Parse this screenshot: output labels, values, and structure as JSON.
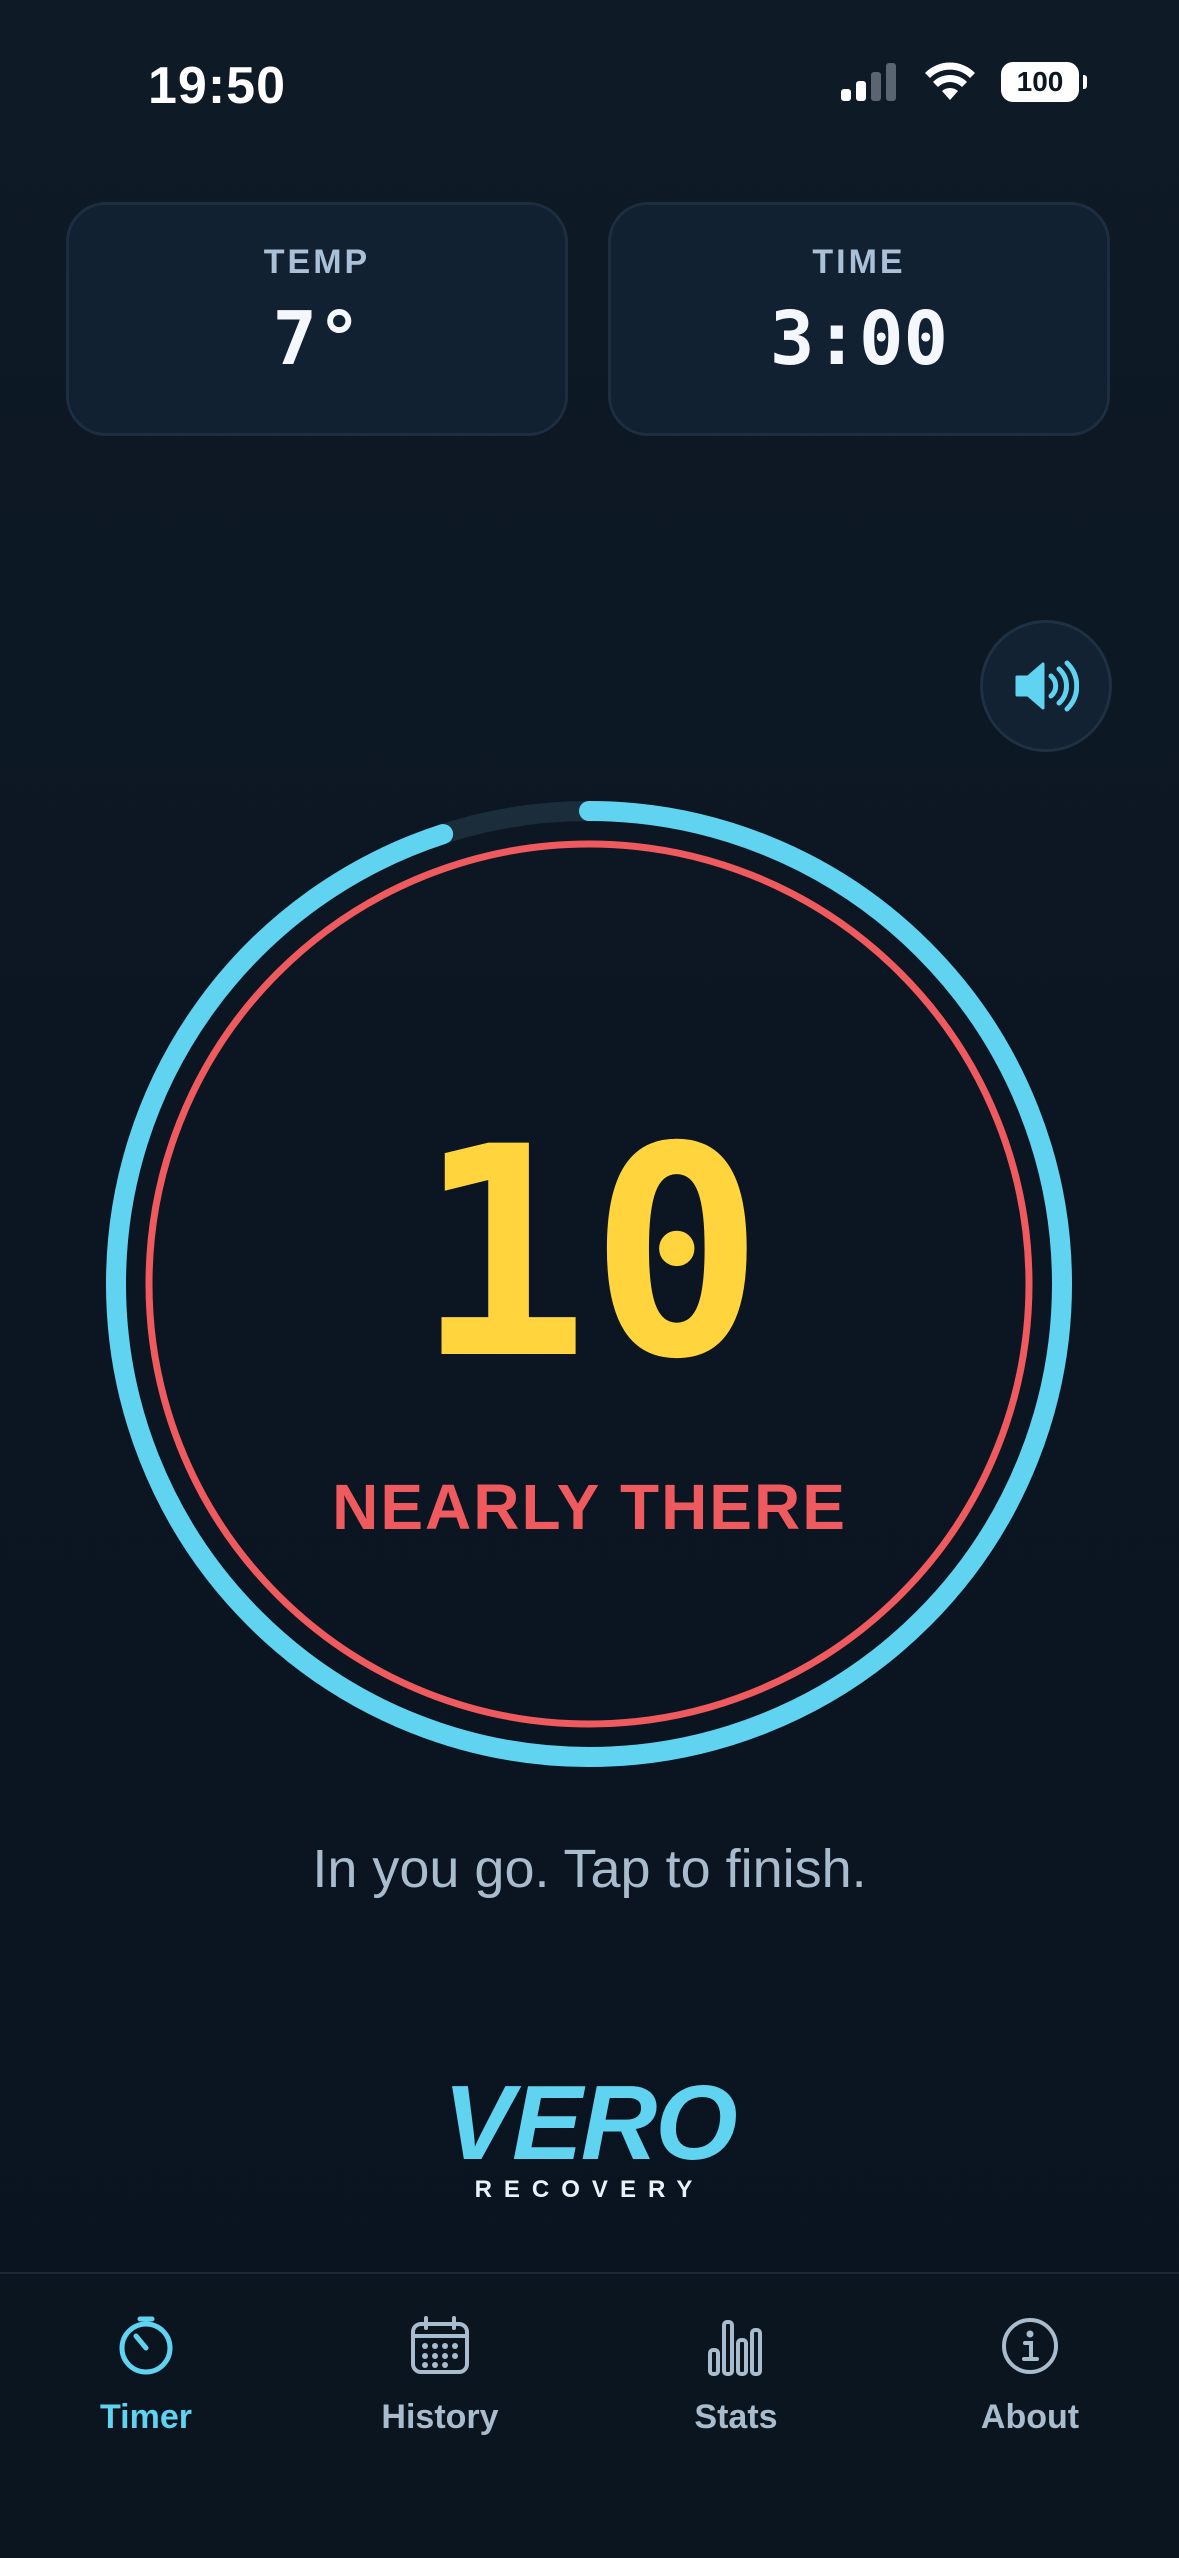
{
  "status": {
    "time": "19:50",
    "battery": "100"
  },
  "cards": {
    "temp": {
      "label": "TEMP",
      "value": "7°"
    },
    "time": {
      "label": "TIME",
      "value": "3:00"
    }
  },
  "timer": {
    "count": "10",
    "phase": "NEARLY THERE",
    "hint": "In you go. Tap to finish.",
    "progress_remaining": 0.95
  },
  "logo": {
    "word": "VERO",
    "sub": "RECOVERY"
  },
  "tabs": [
    {
      "label": "Timer",
      "icon": "timer-icon",
      "active": true
    },
    {
      "label": "History",
      "icon": "calendar-icon",
      "active": false
    },
    {
      "label": "Stats",
      "icon": "bar-chart-icon",
      "active": false
    },
    {
      "label": "About",
      "icon": "info-icon",
      "active": false
    }
  ],
  "colors": {
    "accent": "#5fd3ef",
    "warning": "#ef5a5e",
    "count": "#ffd43d",
    "background": "#0b1622"
  }
}
